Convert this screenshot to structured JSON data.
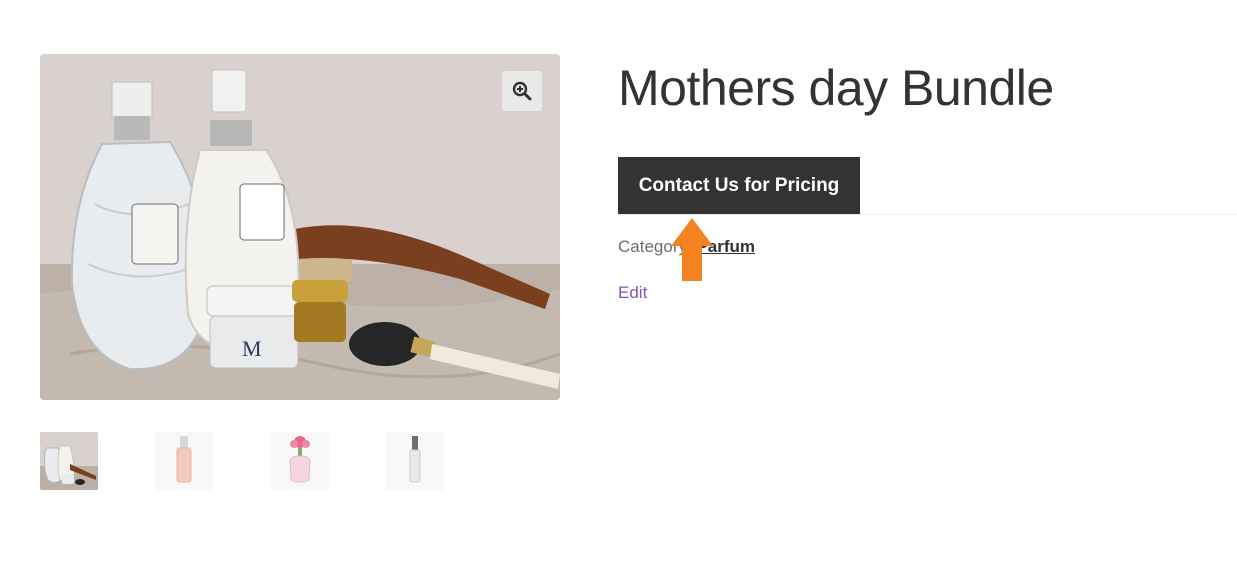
{
  "product": {
    "title": "Mothers day Bundle",
    "cta_label": "Contact Us for Pricing",
    "category_label": "Category:",
    "category_value": "Parfum",
    "edit_label": "Edit"
  },
  "gallery": {
    "thumbnails": [
      {
        "name": "cosmetics-set"
      },
      {
        "name": "pink-perfume-bottle"
      },
      {
        "name": "flower-cap-perfume-bottle"
      },
      {
        "name": "slim-clear-perfume-bottle"
      }
    ]
  },
  "colors": {
    "button_bg": "#333333",
    "edit_link": "#7f54b3",
    "annotation_arrow": "#f58220"
  },
  "icons": {
    "zoom": "zoom-in-icon",
    "arrow": "up-arrow-icon"
  }
}
